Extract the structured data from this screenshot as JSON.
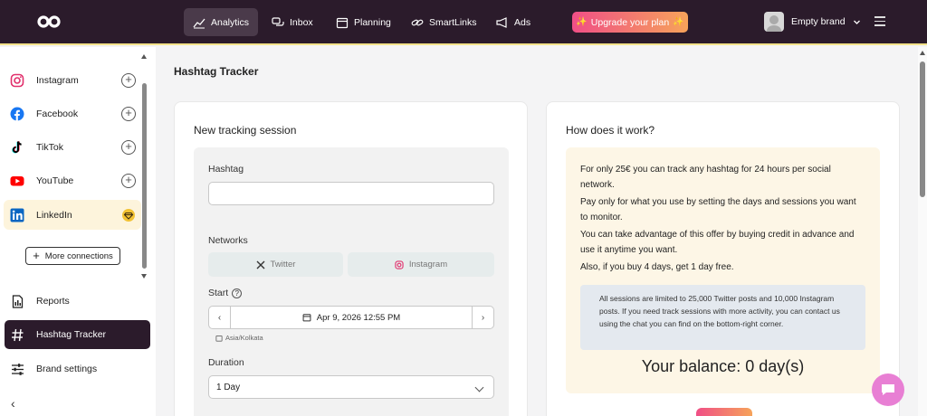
{
  "topbar": {
    "nav": [
      {
        "label": "Analytics",
        "icon": "chart-line-icon"
      },
      {
        "label": "Inbox",
        "icon": "chat-bubbles-icon"
      },
      {
        "label": "Planning",
        "icon": "calendar-icon"
      },
      {
        "label": "SmartLinks",
        "icon": "link-icon"
      },
      {
        "label": "Ads",
        "icon": "megaphone-icon"
      }
    ],
    "upgrade_label": "Upgrade your plan",
    "upgrade_spark": "✨",
    "brand_name": "Empty brand"
  },
  "sidebar": {
    "networks": [
      {
        "label": "Instagram",
        "icon": "instagram-icon",
        "color": "#e1306c"
      },
      {
        "label": "Facebook",
        "icon": "facebook-icon",
        "color": "#1877f2"
      },
      {
        "label": "TikTok",
        "icon": "tiktok-icon",
        "color": "#000000"
      },
      {
        "label": "YouTube",
        "icon": "youtube-icon",
        "color": "#ff0000"
      },
      {
        "label": "LinkedIn",
        "icon": "linkedin-icon",
        "color": "#0a66c2"
      }
    ],
    "more_connections": "More connections",
    "menu": [
      {
        "label": "Reports",
        "icon": "report-icon"
      },
      {
        "label": "Hashtag Tracker",
        "icon": "hashtag-icon"
      },
      {
        "label": "Brand settings",
        "icon": "sliders-icon"
      }
    ],
    "collapse_glyph": "‹"
  },
  "main": {
    "page_title": "Hashtag Tracker",
    "left_card": {
      "title": "New tracking session",
      "hashtag_label": "Hashtag",
      "hashtag_value": "",
      "networks_label": "Networks",
      "network_options": [
        {
          "label": "Twitter",
          "icon": "x-twitter-icon"
        },
        {
          "label": "Instagram",
          "icon": "instagram-icon"
        }
      ],
      "start_label": "Start",
      "help_glyph": "?",
      "start_value": "Apr 9, 2026 12:55 PM",
      "timezone": "Asia/Kolkata",
      "duration_label": "Duration",
      "duration_value": "1 Day"
    },
    "right_card": {
      "title": "How does it work?",
      "paragraphs": [
        "For only 25€ you can track any hashtag for 24 hours per social network.",
        "Pay only for what you use by setting the days and sessions you want to monitor.",
        "You can take advantage of this offer by buying credit in advance and use it anytime you want.",
        "Also, if you buy 4 days, get 1 day free."
      ],
      "notice": "All sessions are limited to 25,000 Twitter posts and 10,000 Instagram posts. If you need track sessions with more activity, you can contact us using the chat you can find on the bottom-right corner.",
      "balance": "Your balance: 0 day(s)"
    }
  },
  "colors": {
    "topbar_bg": "#2b1b2b",
    "accent_gradient_start": "#f04f86",
    "accent_gradient_end": "#f6a35a",
    "info_bg": "#fdf6e6",
    "notice_bg": "#e4e9ef",
    "chat_fab": "#e87fd4"
  }
}
